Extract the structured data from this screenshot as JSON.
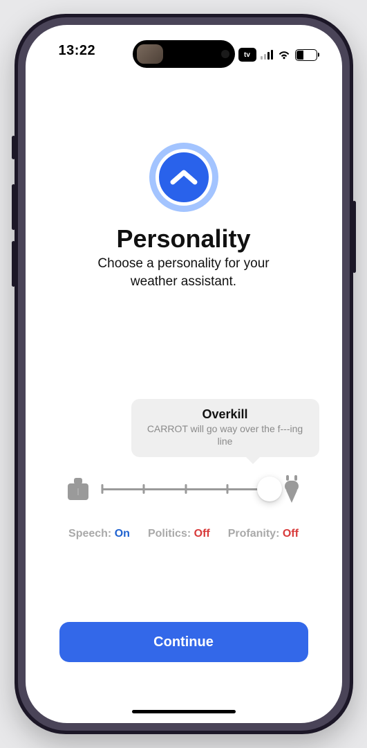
{
  "status": {
    "time": "13:22",
    "tv_badge": "tv",
    "battery_percent": "35"
  },
  "hero": {
    "title": "Personality",
    "subtitle": "Choose a personality for your weather assistant."
  },
  "slider": {
    "tooltip_title": "Overkill",
    "tooltip_sub": "CARROT will go way over the f---ing line",
    "min": 0,
    "max": 4,
    "value": 4,
    "tick_count": 5
  },
  "toggles": {
    "speech": {
      "label": "Speech:",
      "value": "On",
      "state": "on"
    },
    "politics": {
      "label": "Politics:",
      "value": "Off",
      "state": "off"
    },
    "profanity": {
      "label": "Profanity:",
      "value": "Off",
      "state": "off"
    }
  },
  "cta": {
    "continue": "Continue"
  }
}
